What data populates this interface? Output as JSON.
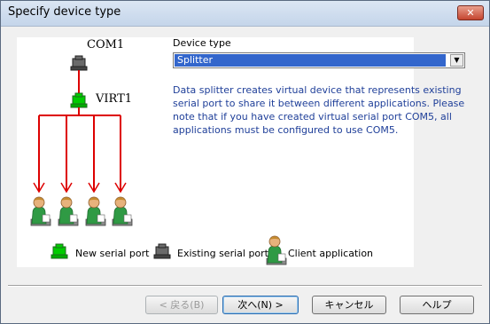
{
  "window": {
    "title": "Specify device type",
    "close_glyph": "✕"
  },
  "diagram": {
    "port_label": "COM1",
    "virtual_label": "VIRT1"
  },
  "legend": {
    "new_port": "New serial port",
    "existing_port": "Existing serial port",
    "client_app": "Client application"
  },
  "device_type": {
    "label": "Device type",
    "selected": "Splitter",
    "arrow_glyph": "▼",
    "description": "Data splitter creates virtual device that represents existing serial port to share it between different applications. Please note that if you have created virtual serial port COM5, all applications must be configured to use COM5."
  },
  "buttons": {
    "back": "< 戻る(B)",
    "next": "次へ(N) >",
    "cancel": "キャンセル",
    "help": "ヘルプ"
  },
  "colors": {
    "arrow": "#dd0000",
    "new_port": "#00cc00",
    "existing_port": "#606060",
    "description_text": "#1f3f99",
    "selection": "#3366cc"
  },
  "icons": {
    "new_port": "green-serial-port-icon",
    "existing_port": "gray-serial-port-icon",
    "client": "user-computer-icon",
    "close": "close-icon",
    "dropdown": "chevron-down-icon"
  }
}
